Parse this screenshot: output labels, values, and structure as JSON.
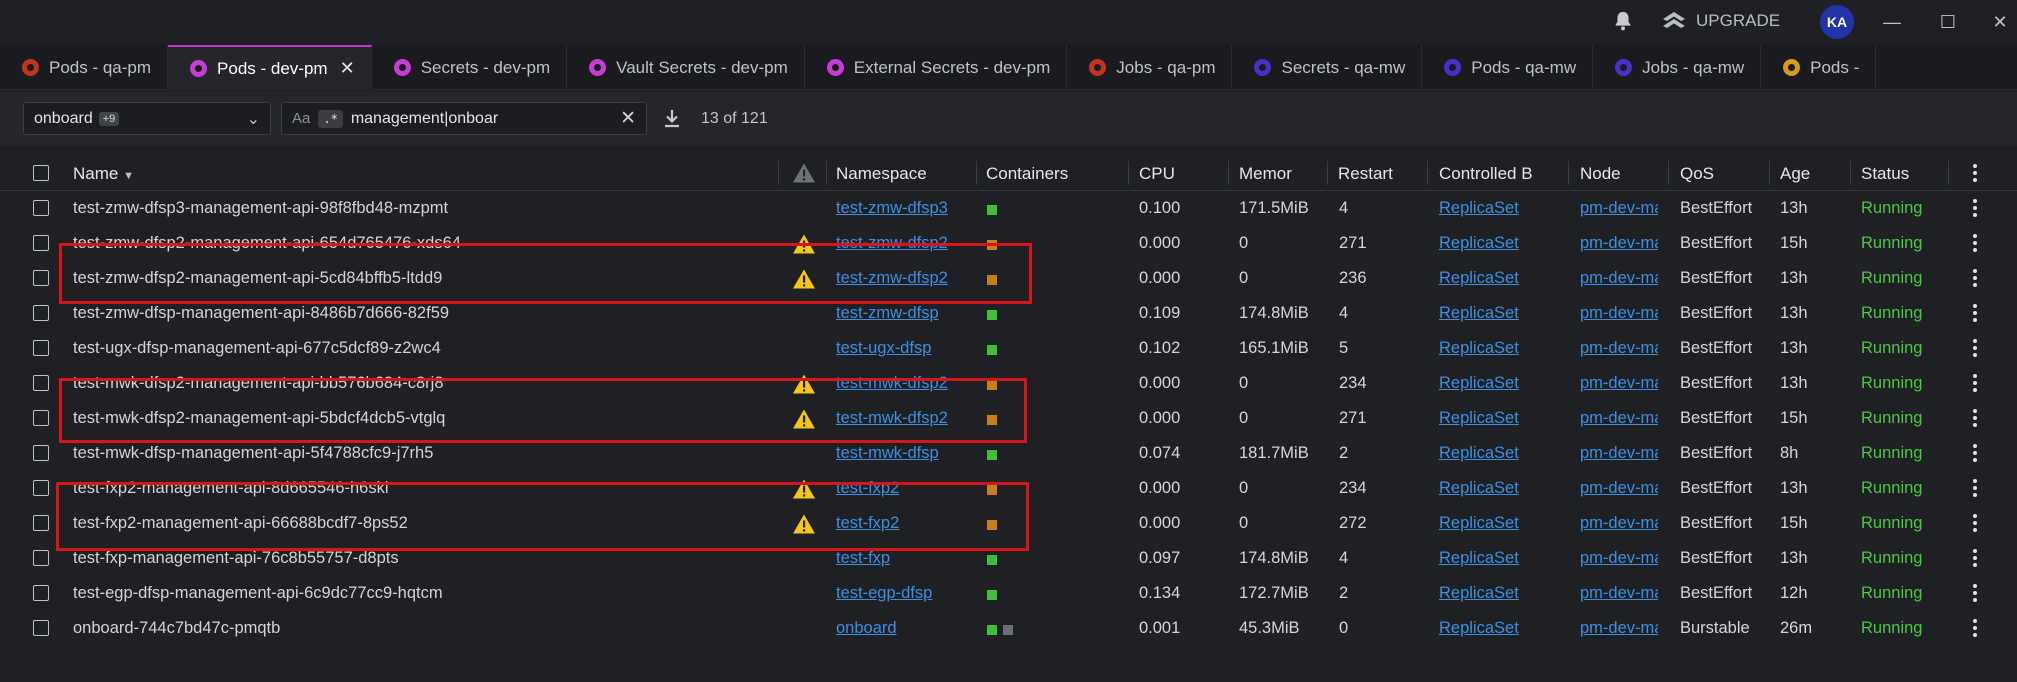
{
  "titlebar": {
    "upgrade_label": "UPGRADE",
    "avatar_initials": "KA",
    "icons": [
      "bell-icon",
      "upgrade-icon",
      "minimize-icon",
      "maximize-icon",
      "close-icon"
    ]
  },
  "tabs": [
    {
      "label": "Pods - qa-pm",
      "icon_color": "#c23420",
      "active": false
    },
    {
      "label": "Pods - dev-pm",
      "icon_color": "#c53dd3",
      "active": true
    },
    {
      "label": "Secrets - dev-pm",
      "icon_color": "#c53dd3",
      "active": false
    },
    {
      "label": "Vault Secrets - dev-pm",
      "icon_color": "#c53dd3",
      "active": false
    },
    {
      "label": "External Secrets - dev-pm",
      "icon_color": "#c53dd3",
      "active": false
    },
    {
      "label": "Jobs - qa-pm",
      "icon_color": "#c23420",
      "active": false
    },
    {
      "label": "Secrets - qa-mw",
      "icon_color": "#4a2fc9",
      "active": false
    },
    {
      "label": "Pods - qa-mw",
      "icon_color": "#4a2fc9",
      "active": false
    },
    {
      "label": "Jobs - qa-mw",
      "icon_color": "#4a2fc9",
      "active": false
    },
    {
      "label": "Pods -",
      "icon_color": "#d99a1c",
      "active": false
    }
  ],
  "filters": {
    "namespace_selected": "onboard",
    "namespace_extra": "+9",
    "search_case_label": "Aa",
    "search_regex_label": ".*",
    "search_value": "management|onboar",
    "result_count": "13 of 121"
  },
  "columns": [
    "Name",
    "Namespace",
    "Containers",
    "CPU",
    "Memor",
    "Restart",
    "Controlled B",
    "Node",
    "QoS",
    "Age",
    "Status"
  ],
  "rows": [
    {
      "name": "test-zmw-dfsp3-management-api-98f8fbd48-mzpmt",
      "warning": false,
      "namespace": "test-zmw-dfsp3",
      "containers": [
        "#3ec13b"
      ],
      "cpu": "0.100",
      "memory": "171.5MiB",
      "restarts": "4",
      "controlled_by": "ReplicaSet",
      "node": "pm-dev-ma",
      "qos": "BestEffort",
      "age": "13h",
      "status": "Running"
    },
    {
      "name": "test-zmw-dfsp2-management-api-654d765476-xds64",
      "warning": true,
      "namespace": "test-zmw-dfsp2",
      "containers": [
        "#c8801d"
      ],
      "cpu": "0.000",
      "memory": "0",
      "restarts": "271",
      "controlled_by": "ReplicaSet",
      "node": "pm-dev-ma",
      "qos": "BestEffort",
      "age": "15h",
      "status": "Running"
    },
    {
      "name": "test-zmw-dfsp2-management-api-5cd84bffb5-ltdd9",
      "warning": true,
      "namespace": "test-zmw-dfsp2",
      "containers": [
        "#c8801d"
      ],
      "cpu": "0.000",
      "memory": "0",
      "restarts": "236",
      "controlled_by": "ReplicaSet",
      "node": "pm-dev-ma",
      "qos": "BestEffort",
      "age": "13h",
      "status": "Running"
    },
    {
      "name": "test-zmw-dfsp-management-api-8486b7d666-82f59",
      "warning": false,
      "namespace": "test-zmw-dfsp",
      "containers": [
        "#3ec13b"
      ],
      "cpu": "0.109",
      "memory": "174.8MiB",
      "restarts": "4",
      "controlled_by": "ReplicaSet",
      "node": "pm-dev-ma",
      "qos": "BestEffort",
      "age": "13h",
      "status": "Running"
    },
    {
      "name": "test-ugx-dfsp-management-api-677c5dcf89-z2wc4",
      "warning": false,
      "namespace": "test-ugx-dfsp",
      "containers": [
        "#3ec13b"
      ],
      "cpu": "0.102",
      "memory": "165.1MiB",
      "restarts": "5",
      "controlled_by": "ReplicaSet",
      "node": "pm-dev-ma",
      "qos": "BestEffort",
      "age": "13h",
      "status": "Running"
    },
    {
      "name": "test-mwk-dfsp2-management-api-bb576b684-c8rj8",
      "warning": true,
      "namespace": "test-mwk-dfsp2",
      "containers": [
        "#c8801d"
      ],
      "cpu": "0.000",
      "memory": "0",
      "restarts": "234",
      "controlled_by": "ReplicaSet",
      "node": "pm-dev-ma",
      "qos": "BestEffort",
      "age": "13h",
      "status": "Running"
    },
    {
      "name": "test-mwk-dfsp2-management-api-5bdcf4dcb5-vtglq",
      "warning": true,
      "namespace": "test-mwk-dfsp2",
      "containers": [
        "#c8801d"
      ],
      "cpu": "0.000",
      "memory": "0",
      "restarts": "271",
      "controlled_by": "ReplicaSet",
      "node": "pm-dev-ma",
      "qos": "BestEffort",
      "age": "15h",
      "status": "Running"
    },
    {
      "name": "test-mwk-dfsp-management-api-5f4788cfc9-j7rh5",
      "warning": false,
      "namespace": "test-mwk-dfsp",
      "containers": [
        "#3ec13b"
      ],
      "cpu": "0.074",
      "memory": "181.7MiB",
      "restarts": "2",
      "controlled_by": "ReplicaSet",
      "node": "pm-dev-ma",
      "qos": "BestEffort",
      "age": "8h",
      "status": "Running"
    },
    {
      "name": "test-fxp2-management-api-8d665546-h6skl",
      "warning": true,
      "namespace": "test-fxp2",
      "containers": [
        "#c8801d"
      ],
      "cpu": "0.000",
      "memory": "0",
      "restarts": "234",
      "controlled_by": "ReplicaSet",
      "node": "pm-dev-ma",
      "qos": "BestEffort",
      "age": "13h",
      "status": "Running"
    },
    {
      "name": "test-fxp2-management-api-66688bcdf7-8ps52",
      "warning": true,
      "namespace": "test-fxp2",
      "containers": [
        "#c8801d"
      ],
      "cpu": "0.000",
      "memory": "0",
      "restarts": "272",
      "controlled_by": "ReplicaSet",
      "node": "pm-dev-ma",
      "qos": "BestEffort",
      "age": "15h",
      "status": "Running"
    },
    {
      "name": "test-fxp-management-api-76c8b55757-d8pts",
      "warning": false,
      "namespace": "test-fxp",
      "containers": [
        "#3ec13b"
      ],
      "cpu": "0.097",
      "memory": "174.8MiB",
      "restarts": "4",
      "controlled_by": "ReplicaSet",
      "node": "pm-dev-ma",
      "qos": "BestEffort",
      "age": "13h",
      "status": "Running"
    },
    {
      "name": "test-egp-dfsp-management-api-6c9dc77cc9-hqtcm",
      "warning": false,
      "namespace": "test-egp-dfsp",
      "containers": [
        "#3ec13b"
      ],
      "cpu": "0.134",
      "memory": "172.7MiB",
      "restarts": "2",
      "controlled_by": "ReplicaSet",
      "node": "pm-dev-ma",
      "qos": "BestEffort",
      "age": "12h",
      "status": "Running"
    },
    {
      "name": "onboard-744c7bd47c-pmqtb",
      "warning": false,
      "namespace": "onboard",
      "containers": [
        "#3ec13b",
        "#6b6e74"
      ],
      "cpu": "0.001",
      "memory": "45.3MiB",
      "restarts": "0",
      "controlled_by": "ReplicaSet",
      "node": "pm-dev-ma",
      "qos": "Burstable",
      "age": "26m",
      "status": "Running"
    }
  ],
  "colors": {
    "accent_tab": "#c23ad1",
    "link": "#3d8fe4",
    "status_running": "#4cc746",
    "highlight_box": "#d7161b",
    "warning": "#f5c518"
  }
}
